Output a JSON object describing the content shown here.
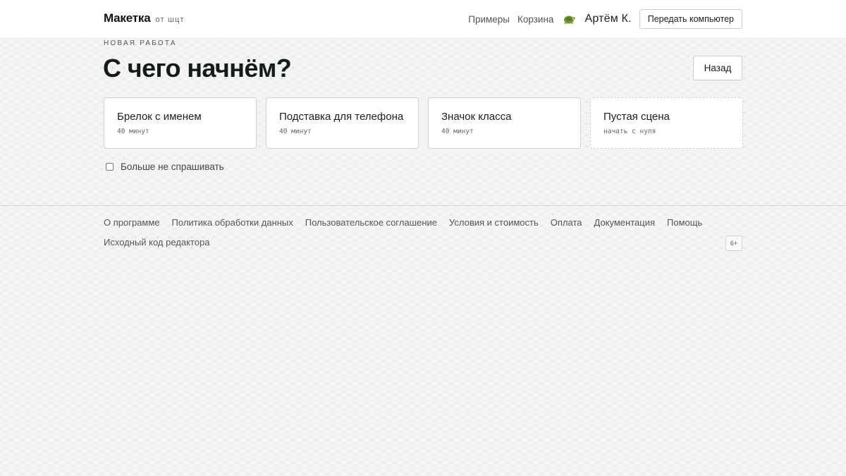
{
  "header": {
    "brand_name": "Макетка",
    "brand_sub": "от шцт",
    "nav": [
      "Примеры",
      "Корзина"
    ],
    "avatar_icon": "turtle-icon",
    "user_name": "Артём К.",
    "handoff_label": "Передать компьютер"
  },
  "main": {
    "eyebrow": "НОВАЯ РАБОТА",
    "title": "С чего начнём?",
    "back_label": "Назад",
    "cards": [
      {
        "title": "Брелок с именем",
        "meta": "40 минут"
      },
      {
        "title": "Подставка для телефона",
        "meta": "40 минут"
      },
      {
        "title": "Значок класса",
        "meta": "40 минут"
      },
      {
        "title": "Пустая сцена",
        "meta": "начать с нуля"
      }
    ],
    "dont_ask_label": "Больше не спрашивать"
  },
  "footer": {
    "links_row1": [
      "О программе",
      "Политика обработки данных",
      "Пользовательское соглашение",
      "Условия и стоимость",
      "Оплата",
      "Документация",
      "Помощь"
    ],
    "links_row2": [
      "Исходный код редактора"
    ],
    "age_rating": "6+"
  }
}
